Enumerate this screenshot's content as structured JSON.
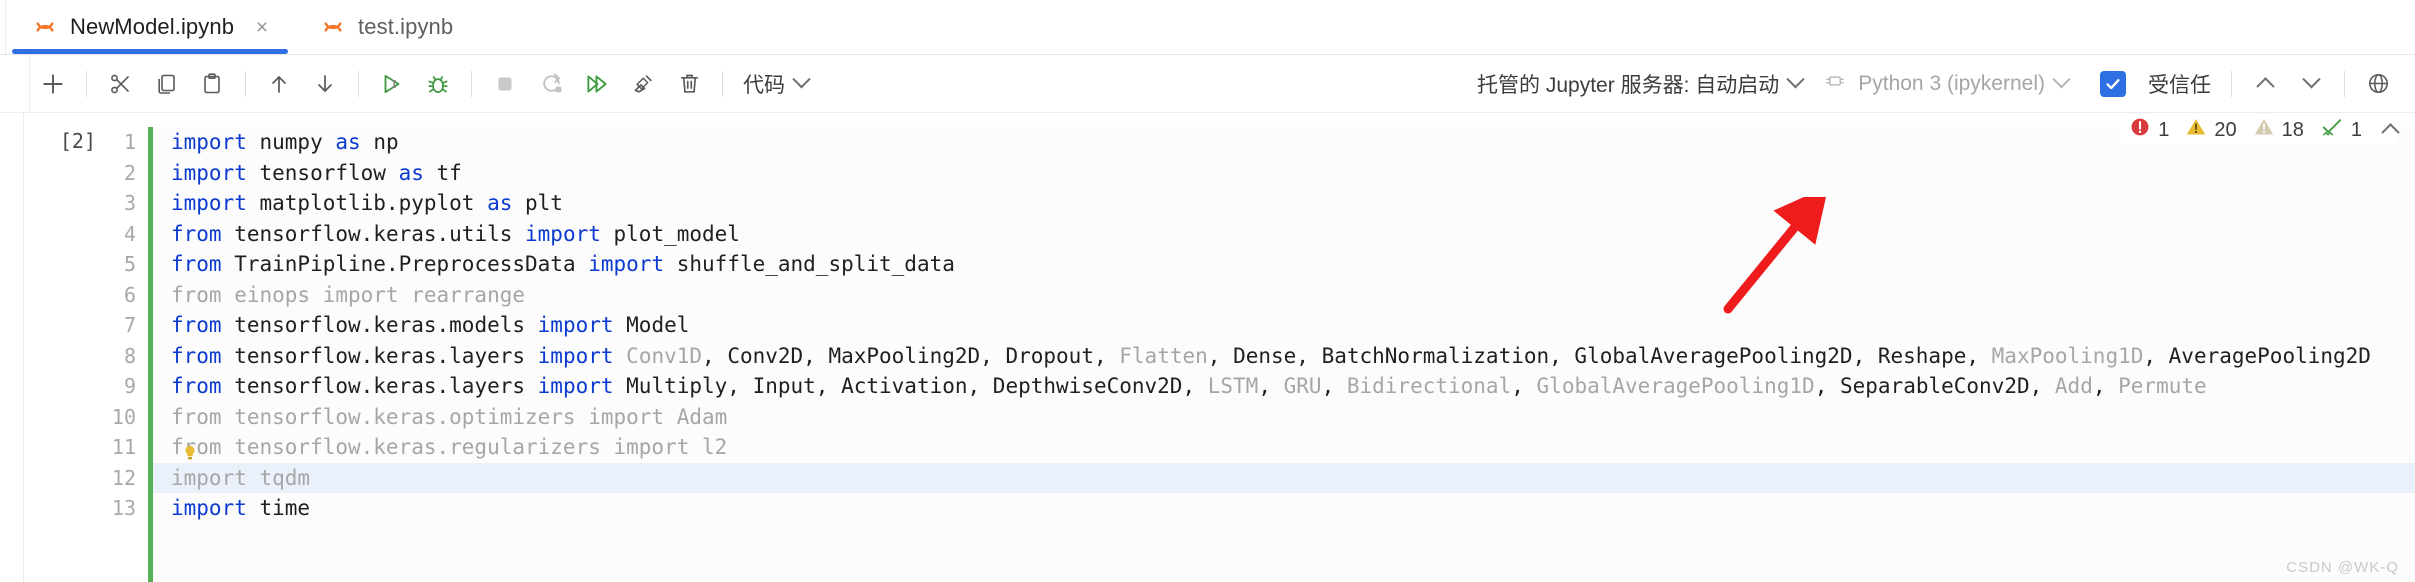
{
  "tabs": [
    {
      "label": "NewModel.ipynb",
      "icon": "jupyter-notebook-icon",
      "active": true,
      "close": "×"
    },
    {
      "label": "test.ipynb",
      "icon": "jupyter-notebook-icon",
      "active": false,
      "close": ""
    }
  ],
  "toolbar": {
    "add_label": "+",
    "buttons": [
      {
        "name": "add-cell-button",
        "icon": "plus-icon"
      },
      {
        "name": "cut-cell-button",
        "icon": "scissors-icon"
      },
      {
        "name": "copy-cell-button",
        "icon": "copy-icon"
      },
      {
        "name": "paste-cell-button",
        "icon": "paste-icon"
      },
      {
        "name": "move-cell-up-button",
        "icon": "arrow-up-icon"
      },
      {
        "name": "move-cell-down-button",
        "icon": "arrow-down-icon"
      },
      {
        "name": "run-cell-button",
        "icon": "run-play-icon"
      },
      {
        "name": "debug-cell-button",
        "icon": "bug-icon"
      },
      {
        "name": "interrupt-kernel-button",
        "icon": "stop-square-icon"
      },
      {
        "name": "restart-kernel-button",
        "icon": "restart-circle-icon"
      },
      {
        "name": "run-all-cells-button",
        "icon": "double-play-icon"
      },
      {
        "name": "clear-outputs-button",
        "icon": "broom-icon"
      },
      {
        "name": "delete-cell-button",
        "icon": "trash-icon"
      }
    ],
    "cell_type": "代码",
    "jupyter_server": "托管的 Jupyter 服务器: 自动启动",
    "kernel": "Python 3 (ipykernel)",
    "trusted": "受信任",
    "outline_up": "⌃",
    "outline_down": "⌄"
  },
  "problems": {
    "errors": "1",
    "warnings": "20",
    "infos": "18",
    "hints": "1"
  },
  "cell": {
    "execution_count": "[2]",
    "highlight_line": 12,
    "lines": [
      {
        "no": "1",
        "tokens": [
          {
            "t": "import",
            "c": "kw"
          },
          {
            "t": " numpy ",
            "c": "plain"
          },
          {
            "t": "as",
            "c": "kw"
          },
          {
            "t": " np",
            "c": "plain"
          }
        ]
      },
      {
        "no": "2",
        "tokens": [
          {
            "t": "import",
            "c": "kw"
          },
          {
            "t": " tensorflow ",
            "c": "plain"
          },
          {
            "t": "as",
            "c": "kw"
          },
          {
            "t": " tf",
            "c": "plain"
          }
        ]
      },
      {
        "no": "3",
        "tokens": [
          {
            "t": "import",
            "c": "kw"
          },
          {
            "t": " matplotlib.pyplot ",
            "c": "plain"
          },
          {
            "t": "as",
            "c": "kw"
          },
          {
            "t": " plt",
            "c": "plain"
          }
        ]
      },
      {
        "no": "4",
        "tokens": [
          {
            "t": "from",
            "c": "kw"
          },
          {
            "t": " tensorflow.keras.utils ",
            "c": "plain"
          },
          {
            "t": "import",
            "c": "kw"
          },
          {
            "t": " plot_model",
            "c": "plain"
          }
        ]
      },
      {
        "no": "5",
        "tokens": [
          {
            "t": "from",
            "c": "kw"
          },
          {
            "t": " TrainPipline.PreprocessData ",
            "c": "plain"
          },
          {
            "t": "import",
            "c": "kw"
          },
          {
            "t": " shuffle_and_split_data",
            "c": "plain"
          }
        ]
      },
      {
        "no": "6",
        "tokens": [
          {
            "t": "from einops import rearrange",
            "c": "dim"
          }
        ]
      },
      {
        "no": "7",
        "tokens": [
          {
            "t": "from",
            "c": "kw"
          },
          {
            "t": " tensorflow.keras.models ",
            "c": "plain"
          },
          {
            "t": "import",
            "c": "kw"
          },
          {
            "t": " Model",
            "c": "plain"
          }
        ]
      },
      {
        "no": "8",
        "tokens": [
          {
            "t": "from",
            "c": "kw"
          },
          {
            "t": " tensorflow.keras.layers ",
            "c": "plain"
          },
          {
            "t": "import",
            "c": "kw"
          },
          {
            "t": " ",
            "c": "plain"
          },
          {
            "t": "Conv1D",
            "c": "dim"
          },
          {
            "t": ", Conv2D, MaxPooling2D, Dropout, ",
            "c": "plain"
          },
          {
            "t": "Flatten",
            "c": "dim"
          },
          {
            "t": ", Dense, BatchNormalization, GlobalAveragePooling2D, Reshape, ",
            "c": "plain"
          },
          {
            "t": "MaxPooling1D",
            "c": "dim"
          },
          {
            "t": ", AveragePooling2D",
            "c": "plain"
          }
        ]
      },
      {
        "no": "9",
        "tokens": [
          {
            "t": "from",
            "c": "kw"
          },
          {
            "t": " tensorflow.keras.layers ",
            "c": "plain"
          },
          {
            "t": "import",
            "c": "kw"
          },
          {
            "t": " Multiply, Input, Activation, DepthwiseConv2D, ",
            "c": "plain"
          },
          {
            "t": "LSTM",
            "c": "dim"
          },
          {
            "t": ", ",
            "c": "plain"
          },
          {
            "t": "GRU",
            "c": "dim"
          },
          {
            "t": ", ",
            "c": "plain"
          },
          {
            "t": "Bidirectional",
            "c": "dim"
          },
          {
            "t": ", ",
            "c": "plain"
          },
          {
            "t": "GlobalAveragePooling1D",
            "c": "dim"
          },
          {
            "t": ", SeparableConv2D, ",
            "c": "plain"
          },
          {
            "t": "Add",
            "c": "dim"
          },
          {
            "t": ", ",
            "c": "plain"
          },
          {
            "t": "Permute",
            "c": "dim"
          }
        ]
      },
      {
        "no": "10",
        "tokens": [
          {
            "t": "from tensorflow.keras.optimizers import Adam",
            "c": "dim"
          }
        ]
      },
      {
        "no": "11",
        "tokens": [
          {
            "t": "from tensorflow.keras.regularizers import l2",
            "c": "dim"
          }
        ]
      },
      {
        "no": "12",
        "tokens": [
          {
            "t": "import tqdm",
            "c": "dim"
          }
        ]
      },
      {
        "no": "13",
        "tokens": [
          {
            "t": "import",
            "c": "kw"
          },
          {
            "t": " time",
            "c": "plain"
          }
        ]
      }
    ]
  },
  "annotation": {
    "arrow_color": "#ee1c1c"
  },
  "watermark": "CSDN @WK-Q",
  "colors": {
    "accent": "#2f6fe4",
    "cell_bar": "#54b054",
    "keyword": "#0b3ad1",
    "dimmed": "#a6a6a6",
    "error": "#d73a3a",
    "warning": "#e8b931",
    "info": "#d3cbb0",
    "hint": "#3f9a3f"
  }
}
